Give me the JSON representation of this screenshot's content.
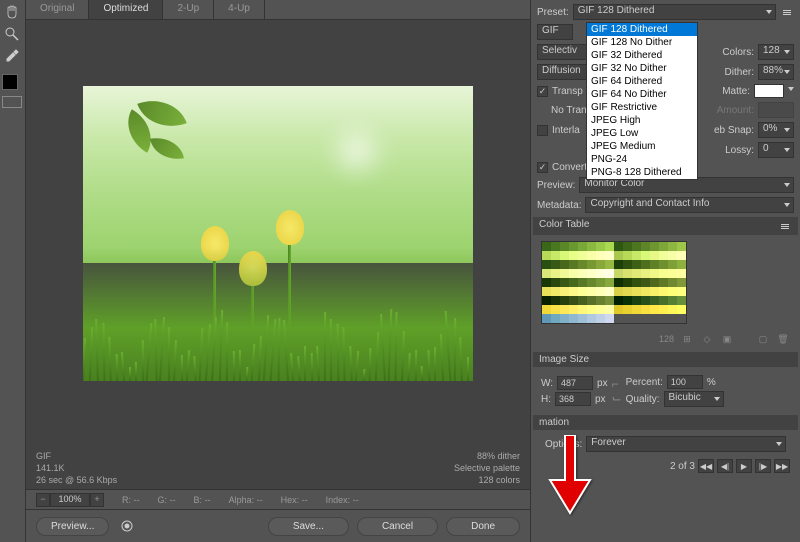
{
  "tabs": {
    "original": "Original",
    "optimized": "Optimized",
    "twoup": "2-Up",
    "fourup": "4-Up"
  },
  "preset": {
    "label": "Preset:",
    "value": "GIF 128 Dithered",
    "options": [
      "GIF 128 Dithered",
      "GIF 128 No Dither",
      "GIF 32 Dithered",
      "GIF 32 No Dither",
      "GIF 64 Dithered",
      "GIF 64 No Dither",
      "GIF Restrictive",
      "JPEG High",
      "JPEG Low",
      "JPEG Medium",
      "PNG-24",
      "PNG-8 128 Dithered"
    ]
  },
  "format_btn": "GIF",
  "reduction": "Selectiv",
  "diffusion": "Diffusion",
  "colors_label": "Colors:",
  "colors_value": "128",
  "dither_label": "Dither:",
  "dither_value": "88%",
  "matte_label": "Matte:",
  "amount_label": "Amount:",
  "transparency": "Transp",
  "no_trans": "No Trans",
  "interlaced": "Interla",
  "websnap_label": "eb Snap:",
  "websnap_value": "0%",
  "lossy_label": "Lossy:",
  "lossy_value": "0",
  "convert_srgb": "Convert to sRGB",
  "preview_label": "Preview:",
  "preview_value": "Monitor Color",
  "metadata_label": "Metadata:",
  "metadata_value": "Copyright and Contact Info",
  "color_table_header": "Color Table",
  "color_table_count": "128",
  "image_size": {
    "header": "Image Size",
    "w": "W:",
    "w_value": "487",
    "h": "H:",
    "h_value": "368",
    "px": "px",
    "percent_label": "Percent:",
    "percent_value": "100",
    "percent_sym": "%",
    "quality_label": "Quality:",
    "quality_value": "Bicubic"
  },
  "animation": {
    "header": "mation",
    "options_label": "Options:",
    "options_value": "Forever",
    "frame_info": "2 of 3"
  },
  "info": {
    "format": "GIF",
    "size": "141.1K",
    "time": "26 sec @ 56.6 Kbps",
    "dither": "88% dither",
    "palette": "Selective palette",
    "ncolors": "128 colors"
  },
  "zoom": {
    "value": "100%",
    "r": "R:",
    "g": "G:",
    "b": "B:",
    "alpha": "Alpha:",
    "hex": "Hex:",
    "index": "Index:",
    "dashes": "--"
  },
  "buttons": {
    "preview": "Preview...",
    "save": "Save...",
    "cancel": "Cancel",
    "done": "Done"
  },
  "ct_colors": [
    "#3a6818",
    "#4a7820",
    "#5a8828",
    "#6a9830",
    "#7aa838",
    "#8ab840",
    "#9ac848",
    "#aad850",
    "#2e5812",
    "#3e6618",
    "#4e7620",
    "#5e8628",
    "#6e9630",
    "#7ea638",
    "#8eb640",
    "#9ec648",
    "#b8d858",
    "#c8e868",
    "#d8f878",
    "#e8ff88",
    "#f0ff98",
    "#f8ffa8",
    "#ffffb8",
    "#ffffc8",
    "#a8c850",
    "#b8d858",
    "#c8e868",
    "#d8f878",
    "#e8f888",
    "#f0ff98",
    "#f8ffa8",
    "#ffffb8",
    "#285010",
    "#385816",
    "#48681c",
    "#587824",
    "#68882c",
    "#789834",
    "#88a83c",
    "#98b844",
    "#1e4008",
    "#2e500e",
    "#3e6016",
    "#4e701e",
    "#5e8026",
    "#6e902e",
    "#7ea036",
    "#8eb03e",
    "#d8e878",
    "#e8f088",
    "#f0f898",
    "#f8ffa8",
    "#fcffb8",
    "#ffffc8",
    "#ffffd8",
    "#ffffe8",
    "#c8d868",
    "#d8e070",
    "#e0e878",
    "#e8f080",
    "#f0f888",
    "#f8ff90",
    "#fcff98",
    "#ffffa0",
    "#183808",
    "#28480e",
    "#385816",
    "#48681e",
    "#587826",
    "#68882e",
    "#789836",
    "#88a83e",
    "#103000",
    "#204006",
    "#30500e",
    "#405816",
    "#50681e",
    "#607826",
    "#708830",
    "#809838",
    "#e8e058",
    "#f0e868",
    "#f8f078",
    "#fff888",
    "#ffff98",
    "#ffffa8",
    "#ffffb8",
    "#ffffc8",
    "#d8d048",
    "#e0d850",
    "#e8e058",
    "#f0e860",
    "#f8f068",
    "#fff870",
    "#ffff78",
    "#ffff80",
    "#082000",
    "#183006",
    "#28400e",
    "#385016",
    "#48601e",
    "#587028",
    "#688030",
    "#789038",
    "#002000",
    "#083006",
    "#184010",
    "#28501a",
    "#386022",
    "#48702a",
    "#588032",
    "#68903a",
    "#f0d838",
    "#f8e048",
    "#ffe858",
    "#fff068",
    "#fff878",
    "#ffff88",
    "#ffff98",
    "#ffffa8",
    "#e0c828",
    "#e8d030",
    "#f0d838",
    "#f8e040",
    "#ffe848",
    "#fff050",
    "#fff858",
    "#ffff60",
    "#6098b8",
    "#70a8c0",
    "#80b0c8",
    "#90b8d0",
    "#a0c0d8",
    "#b0c8e0",
    "#c0d0e8",
    "#d0d8f0"
  ]
}
